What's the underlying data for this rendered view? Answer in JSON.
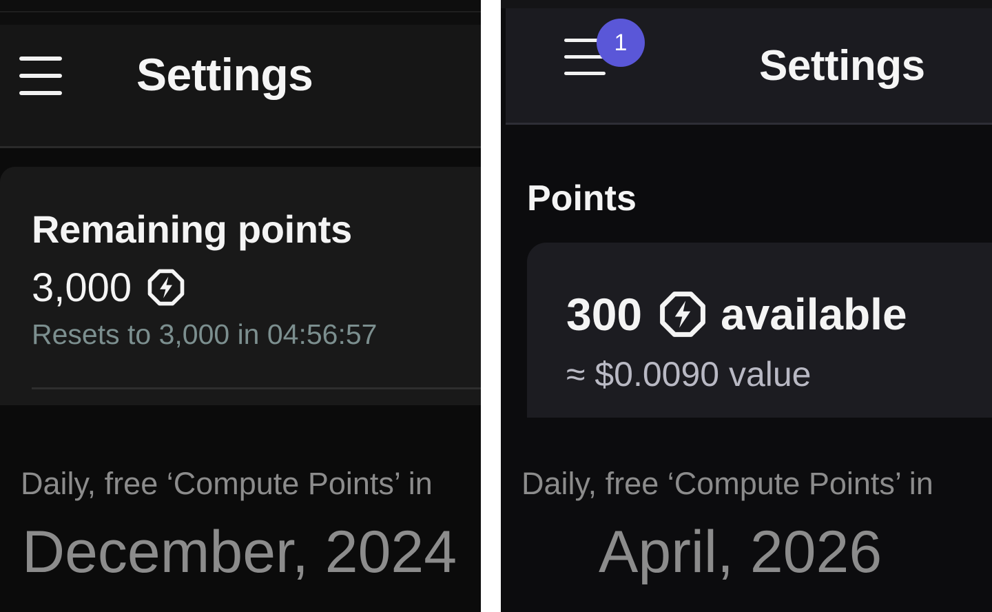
{
  "left_panel": {
    "header": {
      "title": "Settings",
      "menu_icon": "hamburger-menu-icon"
    },
    "points_card": {
      "title": "Remaining points",
      "points_value": "3,000",
      "points_icon": "compute-points-bolt-icon",
      "reset_text": "Resets to 3,000 in 04:56:57"
    },
    "caption": {
      "line1": "Daily, free ‘Compute Points’  in",
      "line2": "December, 2024"
    }
  },
  "right_panel": {
    "header": {
      "title": "Settings",
      "menu_icon": "hamburger-menu-icon",
      "notification_badge": "1"
    },
    "section_heading": "Points",
    "points_card": {
      "available_value": "300",
      "points_icon": "compute-points-bolt-icon",
      "available_label": "available",
      "value_text": "≈ $0.0090 value"
    },
    "caption": {
      "line1": "Daily, free ‘Compute Points’  in",
      "line2": "April, 2026"
    }
  },
  "colors": {
    "badge": "#5a57d8",
    "reset_text": "#7c8f8f",
    "caption_text": "#8c8c8c",
    "value_text": "#b9b9c4"
  }
}
